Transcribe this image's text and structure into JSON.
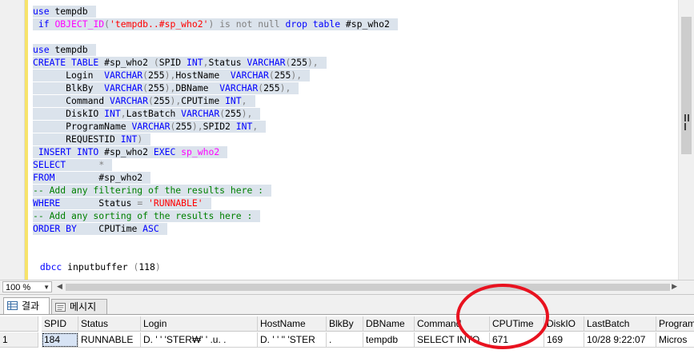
{
  "editor": {
    "lines": [
      [
        {
          "t": "use",
          "c": "kw"
        },
        {
          "t": " tempdb",
          "c": ""
        }
      ],
      [
        {
          "t": " if ",
          "c": "kw"
        },
        {
          "t": "OBJECT_ID",
          "c": "fn"
        },
        {
          "t": "(",
          "c": "gray"
        },
        {
          "t": "'tempdb..#sp_who2'",
          "c": "str"
        },
        {
          "t": ")",
          "c": "gray"
        },
        {
          "t": " is not null ",
          "c": "gray"
        },
        {
          "t": "drop table",
          "c": "kw"
        },
        {
          "t": " #sp_who2",
          "c": ""
        }
      ],
      [],
      [
        {
          "t": "use",
          "c": "kw"
        },
        {
          "t": " tempdb",
          "c": ""
        }
      ],
      [
        {
          "t": "CREATE TABLE",
          "c": "kw"
        },
        {
          "t": " #sp_who2 ",
          "c": ""
        },
        {
          "t": "(",
          "c": "gray"
        },
        {
          "t": "SPID ",
          "c": ""
        },
        {
          "t": "INT",
          "c": "kw"
        },
        {
          "t": ",",
          "c": "gray"
        },
        {
          "t": "Status ",
          "c": ""
        },
        {
          "t": "VARCHAR",
          "c": "kw"
        },
        {
          "t": "(",
          "c": "gray"
        },
        {
          "t": "255",
          "c": ""
        },
        {
          "t": "),",
          "c": "gray"
        }
      ],
      [
        {
          "t": "      Login  ",
          "c": ""
        },
        {
          "t": "VARCHAR",
          "c": "kw"
        },
        {
          "t": "(",
          "c": "gray"
        },
        {
          "t": "255",
          "c": ""
        },
        {
          "t": "),",
          "c": "gray"
        },
        {
          "t": "HostName  ",
          "c": ""
        },
        {
          "t": "VARCHAR",
          "c": "kw"
        },
        {
          "t": "(",
          "c": "gray"
        },
        {
          "t": "255",
          "c": ""
        },
        {
          "t": "),",
          "c": "gray"
        }
      ],
      [
        {
          "t": "      BlkBy  ",
          "c": ""
        },
        {
          "t": "VARCHAR",
          "c": "kw"
        },
        {
          "t": "(",
          "c": "gray"
        },
        {
          "t": "255",
          "c": ""
        },
        {
          "t": "),",
          "c": "gray"
        },
        {
          "t": "DBName  ",
          "c": ""
        },
        {
          "t": "VARCHAR",
          "c": "kw"
        },
        {
          "t": "(",
          "c": "gray"
        },
        {
          "t": "255",
          "c": ""
        },
        {
          "t": "),",
          "c": "gray"
        }
      ],
      [
        {
          "t": "      Command ",
          "c": ""
        },
        {
          "t": "VARCHAR",
          "c": "kw"
        },
        {
          "t": "(",
          "c": "gray"
        },
        {
          "t": "255",
          "c": ""
        },
        {
          "t": "),",
          "c": "gray"
        },
        {
          "t": "CPUTime ",
          "c": ""
        },
        {
          "t": "INT",
          "c": "kw"
        },
        {
          "t": ",",
          "c": "gray"
        }
      ],
      [
        {
          "t": "      DiskIO ",
          "c": ""
        },
        {
          "t": "INT",
          "c": "kw"
        },
        {
          "t": ",",
          "c": "gray"
        },
        {
          "t": "LastBatch ",
          "c": ""
        },
        {
          "t": "VARCHAR",
          "c": "kw"
        },
        {
          "t": "(",
          "c": "gray"
        },
        {
          "t": "255",
          "c": ""
        },
        {
          "t": "),",
          "c": "gray"
        }
      ],
      [
        {
          "t": "      ProgramName ",
          "c": ""
        },
        {
          "t": "VARCHAR",
          "c": "kw"
        },
        {
          "t": "(",
          "c": "gray"
        },
        {
          "t": "255",
          "c": ""
        },
        {
          "t": "),",
          "c": "gray"
        },
        {
          "t": "SPID2 ",
          "c": ""
        },
        {
          "t": "INT",
          "c": "kw"
        },
        {
          "t": ",",
          "c": "gray"
        }
      ],
      [
        {
          "t": "      REQUESTID ",
          "c": ""
        },
        {
          "t": "INT",
          "c": "kw"
        },
        {
          "t": ")",
          "c": "gray"
        }
      ],
      [
        {
          "t": " INSERT INTO",
          "c": "kw"
        },
        {
          "t": " #sp_who2 ",
          "c": ""
        },
        {
          "t": "EXEC",
          "c": "kw"
        },
        {
          "t": " ",
          "c": ""
        },
        {
          "t": "sp_who2",
          "c": "fn"
        }
      ],
      [
        {
          "t": "SELECT",
          "c": "kw"
        },
        {
          "t": "      ",
          "c": ""
        },
        {
          "t": "*",
          "c": "gray"
        }
      ],
      [
        {
          "t": "FROM",
          "c": "kw"
        },
        {
          "t": "        #sp_who2",
          "c": ""
        }
      ],
      [
        {
          "t": "-- Add any filtering of the results here :",
          "c": "cm"
        }
      ],
      [
        {
          "t": "WHERE",
          "c": "kw"
        },
        {
          "t": "       Status ",
          "c": ""
        },
        {
          "t": "=",
          "c": "gray"
        },
        {
          "t": " ",
          "c": ""
        },
        {
          "t": "'RUNNABLE'",
          "c": "str"
        }
      ],
      [
        {
          "t": "-- Add any sorting of the results here :",
          "c": "cm"
        }
      ],
      [
        {
          "t": "ORDER BY",
          "c": "kw"
        },
        {
          "t": "    CPUTime ",
          "c": ""
        },
        {
          "t": "ASC",
          "c": "kw"
        }
      ],
      [],
      [],
      [
        {
          "t": " dbcc",
          "c": "kw"
        },
        {
          "t": " inputbuffer ",
          "c": ""
        },
        {
          "t": "(",
          "c": "gray"
        },
        {
          "t": "118",
          "c": ""
        },
        {
          "t": ")",
          "c": "gray"
        }
      ]
    ]
  },
  "zoom": {
    "value": "100 %"
  },
  "tabs": [
    {
      "label": "결과",
      "icon": "grid-icon"
    },
    {
      "label": "메시지",
      "icon": "message-icon"
    }
  ],
  "results": {
    "columns": [
      "SPID",
      "Status",
      "Login",
      "HostName",
      "BlkBy",
      "DBName",
      "Command",
      "CPUTime",
      "DiskIO",
      "LastBatch",
      "Program"
    ],
    "rows": [
      {
        "num": "1",
        "cells": [
          "184",
          "RUNNABLE",
          "D. ' ' 'STER₩' ' .u. .",
          "D. ' ' '' 'STER",
          ".",
          "tempdb",
          "SELECT INTO",
          "671",
          "169",
          "10/28 9:22:07",
          "Micros"
        ]
      }
    ]
  },
  "colors": {
    "selection": "#dbe3ec",
    "keyword": "#0000ff",
    "string": "#ff0000",
    "function": "#ff00ff",
    "comment": "#008000",
    "annotation": "#e8121f"
  }
}
